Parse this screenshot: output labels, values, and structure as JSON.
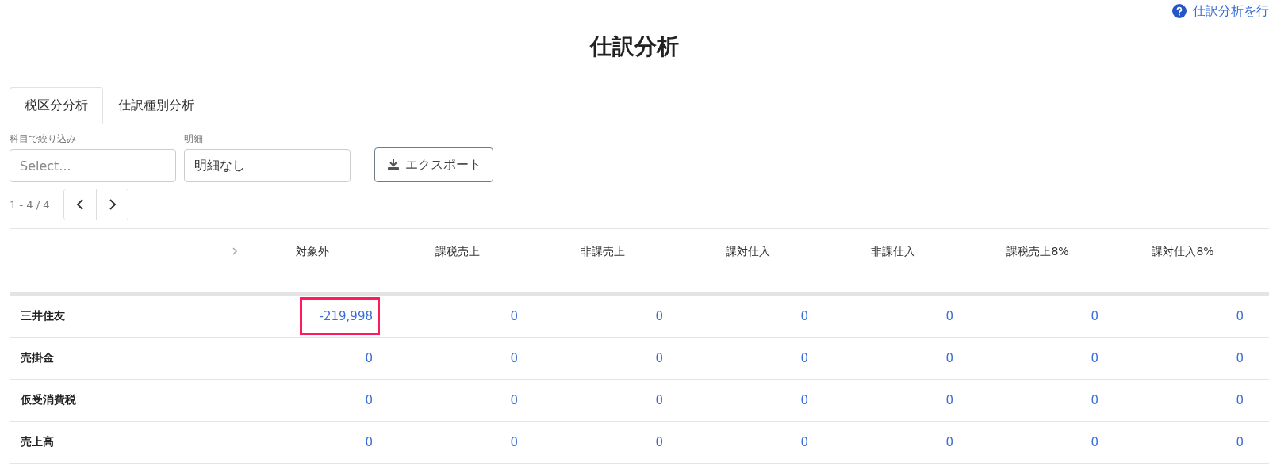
{
  "help_link": {
    "label": "仕訳分析を行"
  },
  "title": "仕訳分析",
  "tabs": [
    {
      "label": "税区分分析",
      "selected": true
    },
    {
      "label": "仕訳種別分析",
      "selected": false
    }
  ],
  "filters": {
    "account": {
      "label": "科目で絞り込み",
      "placeholder": "Select..."
    },
    "detail": {
      "label": "明細",
      "value": "明細なし"
    },
    "export_button": "エクスポート"
  },
  "pagination": {
    "range": "1 - 4 / 4"
  },
  "table": {
    "columns": [
      "対象外",
      "課税売上",
      "非課売上",
      "課対仕入",
      "非課仕入",
      "課税売上8%",
      "課対仕入8%"
    ],
    "rows": [
      {
        "label": "三井住友",
        "cells": [
          {
            "value": "-219,998",
            "highlighted": true
          },
          {
            "value": "0",
            "highlighted": false
          },
          {
            "value": "0",
            "highlighted": false
          },
          {
            "value": "0",
            "highlighted": false
          },
          {
            "value": "0",
            "highlighted": false
          },
          {
            "value": "0",
            "highlighted": false
          },
          {
            "value": "0",
            "highlighted": false
          }
        ]
      },
      {
        "label": "売掛金",
        "cells": [
          {
            "value": "0",
            "highlighted": false
          },
          {
            "value": "0",
            "highlighted": false
          },
          {
            "value": "0",
            "highlighted": false
          },
          {
            "value": "0",
            "highlighted": false
          },
          {
            "value": "0",
            "highlighted": false
          },
          {
            "value": "0",
            "highlighted": false
          },
          {
            "value": "0",
            "highlighted": false
          }
        ]
      },
      {
        "label": "仮受消費税",
        "cells": [
          {
            "value": "0",
            "highlighted": false
          },
          {
            "value": "0",
            "highlighted": false
          },
          {
            "value": "0",
            "highlighted": false
          },
          {
            "value": "0",
            "highlighted": false
          },
          {
            "value": "0",
            "highlighted": false
          },
          {
            "value": "0",
            "highlighted": false
          },
          {
            "value": "0",
            "highlighted": false
          }
        ]
      },
      {
        "label": "売上高",
        "cells": [
          {
            "value": "0",
            "highlighted": false
          },
          {
            "value": "0",
            "highlighted": false
          },
          {
            "value": "0",
            "highlighted": false
          },
          {
            "value": "0",
            "highlighted": false
          },
          {
            "value": "0",
            "highlighted": false
          },
          {
            "value": "0",
            "highlighted": false
          },
          {
            "value": "0",
            "highlighted": false
          }
        ]
      }
    ]
  }
}
